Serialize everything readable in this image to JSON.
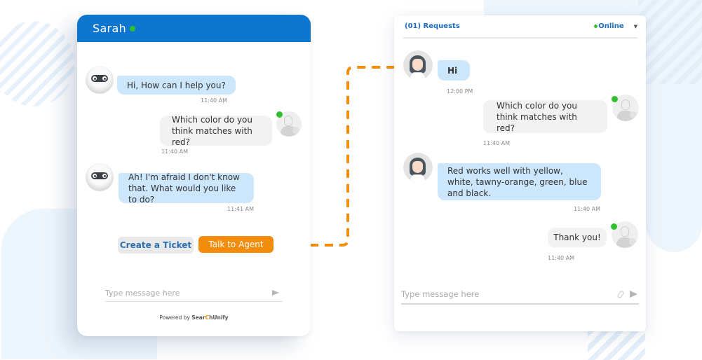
{
  "colors": {
    "brand_blue": "#0f76d0",
    "accent_orange": "#f28c0a",
    "online_green": "#2fc02f",
    "bot_bubble": "#cce6fb",
    "user_bubble": "#f2f2f2"
  },
  "widget": {
    "title": "Sarah",
    "messages": [
      {
        "sender": "bot",
        "text": "Hi, How can I help you?",
        "time": "11:40 AM"
      },
      {
        "sender": "user",
        "text": "Which color do you think matches with red?",
        "time": "11:40 AM"
      },
      {
        "sender": "bot",
        "text": "Ah! I'm afraid I don't know that. What would you like to do?",
        "time": "11:41 AM"
      }
    ],
    "actions": {
      "create_ticket": "Create a Ticket",
      "talk_to_agent": "Talk to Agent"
    },
    "input_placeholder": "Type message here",
    "powered_by": "Powered by",
    "brand_part1": "Sear",
    "brand_part2": "C",
    "brand_part3": "hUnify"
  },
  "console": {
    "requests_label": "(01) Requests",
    "status": "Online",
    "messages": [
      {
        "sender": "agent",
        "text": "Hi",
        "time": "12:00 PM"
      },
      {
        "sender": "user",
        "text": "Which color do you think matches with red?",
        "time": "11:40 AM"
      },
      {
        "sender": "agent",
        "text": "Red works well with yellow, white, tawny-orange, green, blue and black.",
        "time": "11:40 AM"
      },
      {
        "sender": "user",
        "text": "Thank you!",
        "time": "11:40 AM"
      }
    ],
    "input_placeholder": "Type message here"
  }
}
